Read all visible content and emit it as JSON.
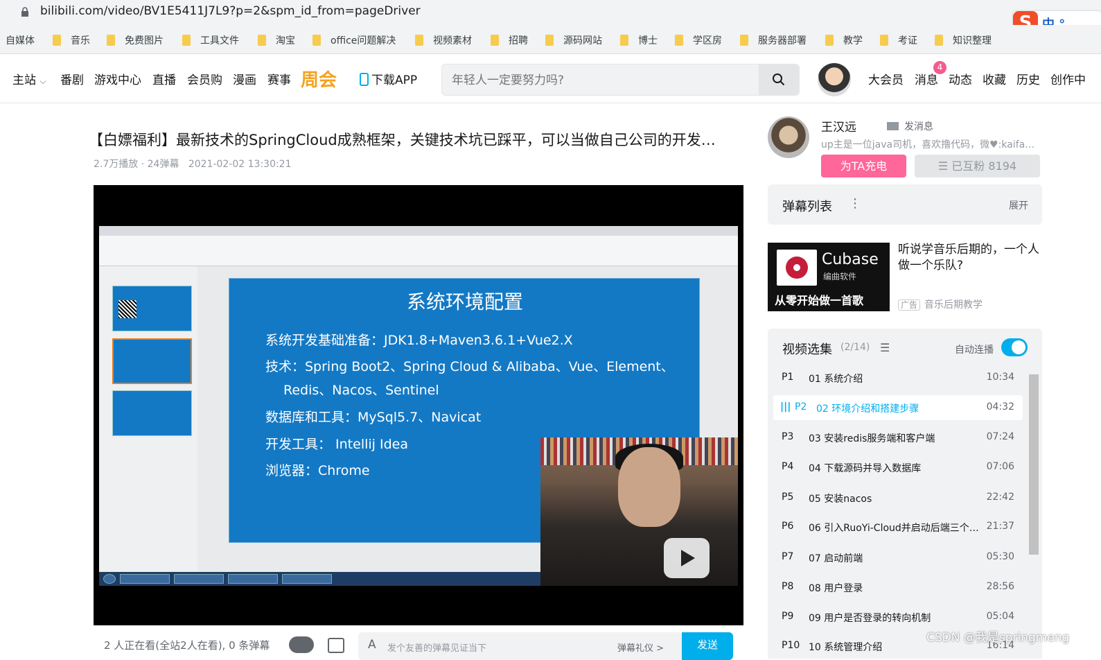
{
  "browser": {
    "url": "bilibili.com/video/BV1E5411J7L9?p=2&spm_id_from=pageDriver",
    "ime": {
      "logo": "S",
      "text": "中 °,"
    },
    "bookmarks": [
      "自媒体",
      "音乐",
      "免费图片",
      "工具文件",
      "淘宝",
      "office问题解决",
      "视频素材",
      "招聘",
      "源码网站",
      "博士",
      "学区房",
      "服务器部署",
      "教学",
      "考证",
      "知识整理"
    ]
  },
  "header": {
    "nav": [
      "主站",
      "番剧",
      "游戏中心",
      "直播",
      "会员购",
      "漫画",
      "赛事"
    ],
    "logo_text": "周会",
    "download": "下载APP",
    "search_placeholder": "年轻人一定要努力吗?",
    "right_nav": [
      "大会员",
      "消息",
      "动态",
      "收藏",
      "历史",
      "创作中"
    ],
    "msg_badge": "4"
  },
  "video": {
    "title": "【白嫖福利】最新技术的SpringCloud成熟框架，关键技术坑已踩平，可以当做自己公司的开发…",
    "plays": "2.7万播放",
    "danmaku_count": "24弹幕",
    "date": "2021-02-02 13:30:21",
    "slide": {
      "title": "系统环境配置",
      "lines": [
        "系统开发基础准备：JDK1.8+Maven3.6.1+Vue2.X",
        "技术：Spring Boot2、Spring Cloud & Alibaba、Vue、Element、",
        "Redis、Nacos、Sentinel",
        "数据库和工具：MySql5.7、Navicat",
        "开发工具： Intellij Idea",
        "浏览器：Chrome"
      ]
    },
    "controls": {
      "viewers": "2 人正在看(全站2人在看), 0 条弹幕",
      "danmaku_placeholder": "发个友善的弹幕见证当下",
      "etiquette": "弹幕礼仪 >",
      "send": "发送"
    }
  },
  "uploader": {
    "name": "王汉远",
    "message": "发消息",
    "desc": "up主是一位java司机，喜欢撸代码，微♥:kaifa…",
    "charge": "为TA充电",
    "fans": "☰ 已互粉 8194"
  },
  "danmaku_list": {
    "title": "弹幕列表",
    "expand": "展开"
  },
  "ad": {
    "brand": "Cubase",
    "brand_sub": "编曲软件",
    "banner": "从零开始做一首歌",
    "text": "听说学音乐后期的，一个人做一个乐队?",
    "tag": "广告",
    "source": "音乐后期教学"
  },
  "playlist": {
    "title": "视频选集",
    "count": "(2/14)",
    "autoplay": "自动连播",
    "episodes": [
      {
        "p": "P1",
        "name": "01 系统介绍",
        "dur": "10:34"
      },
      {
        "p": "P2",
        "name": "02 环境介绍和搭建步骤",
        "dur": "04:32"
      },
      {
        "p": "P3",
        "name": "03 安装redis服务端和客户端",
        "dur": "07:24"
      },
      {
        "p": "P4",
        "name": "04 下载源码并导入数据库",
        "dur": "07:06"
      },
      {
        "p": "P5",
        "name": "05 安装nacos",
        "dur": "22:42"
      },
      {
        "p": "P6",
        "name": "06 引入RuoYi-Cloud并启动后端三个基…",
        "dur": "21:37"
      },
      {
        "p": "P7",
        "name": "07 启动前端",
        "dur": "05:30"
      },
      {
        "p": "P8",
        "name": "08 用户登录",
        "dur": "28:56"
      },
      {
        "p": "P9",
        "name": "09 用户是否登录的转向机制",
        "dur": "05:04"
      },
      {
        "p": "P10",
        "name": "10 系统管理介绍",
        "dur": "16:14"
      }
    ]
  },
  "watermark": "CSDN @我是springmeng",
  "colors": {
    "accent": "#00aeec",
    "pink": "#ff6699",
    "slide": "#1479c5"
  }
}
